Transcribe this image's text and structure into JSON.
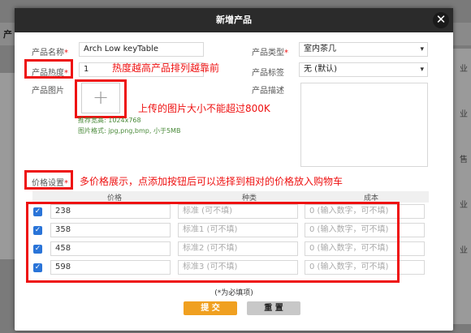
{
  "background": {
    "left_label": "产",
    "right_labels": [
      "业",
      "业",
      "售",
      "业",
      "业"
    ]
  },
  "modal": {
    "title": "新增产品",
    "close_glyph": "✕"
  },
  "form": {
    "name_label": "产品名称",
    "name_value": "Arch Low keyTable",
    "heat_label": "产品热度",
    "heat_value": "1",
    "image_label": "产品图片",
    "upload_glyph": "+",
    "hint_size": "推荐宽高: 1024x768",
    "hint_format": "图片格式: jpg,png,bmp, 小于5MB",
    "type_label": "产品类型",
    "type_value": "室内茶几",
    "tag_label": "产品标签",
    "tag_value": "无 (默认)",
    "desc_label": "产品描述",
    "price_setting_label": "价格设置",
    "required_mark": "*",
    "arrow_glyph": "▾"
  },
  "annotations": {
    "heat": "热度越高产品排列越靠前",
    "image": "上传的图片大小不能超过800K",
    "price": "多价格展示，点添加按钮后可以选择到相对的价格放入购物车"
  },
  "table": {
    "headers": [
      "价格",
      "种类",
      "成本"
    ],
    "rows": [
      {
        "price": "238",
        "kind": "标准 (可不填)",
        "cost": "0 (输入数字，可不填)"
      },
      {
        "price": "358",
        "kind": "标准1 (可不填)",
        "cost": "0 (输入数字，可不填)"
      },
      {
        "price": "458",
        "kind": "标准2 (可不填)",
        "cost": "0 (输入数字，可不填)"
      },
      {
        "price": "598",
        "kind": "标准3 (可不填)",
        "cost": "0 (输入数字，可不填)"
      }
    ]
  },
  "footer": {
    "required_note": "(*为必填项)",
    "submit_label": "提 交",
    "reset_label": "重 置"
  },
  "colors": {
    "accent": "#f0a020",
    "annotation_red": "#e11111",
    "checkbox_blue": "#2a74d8"
  }
}
